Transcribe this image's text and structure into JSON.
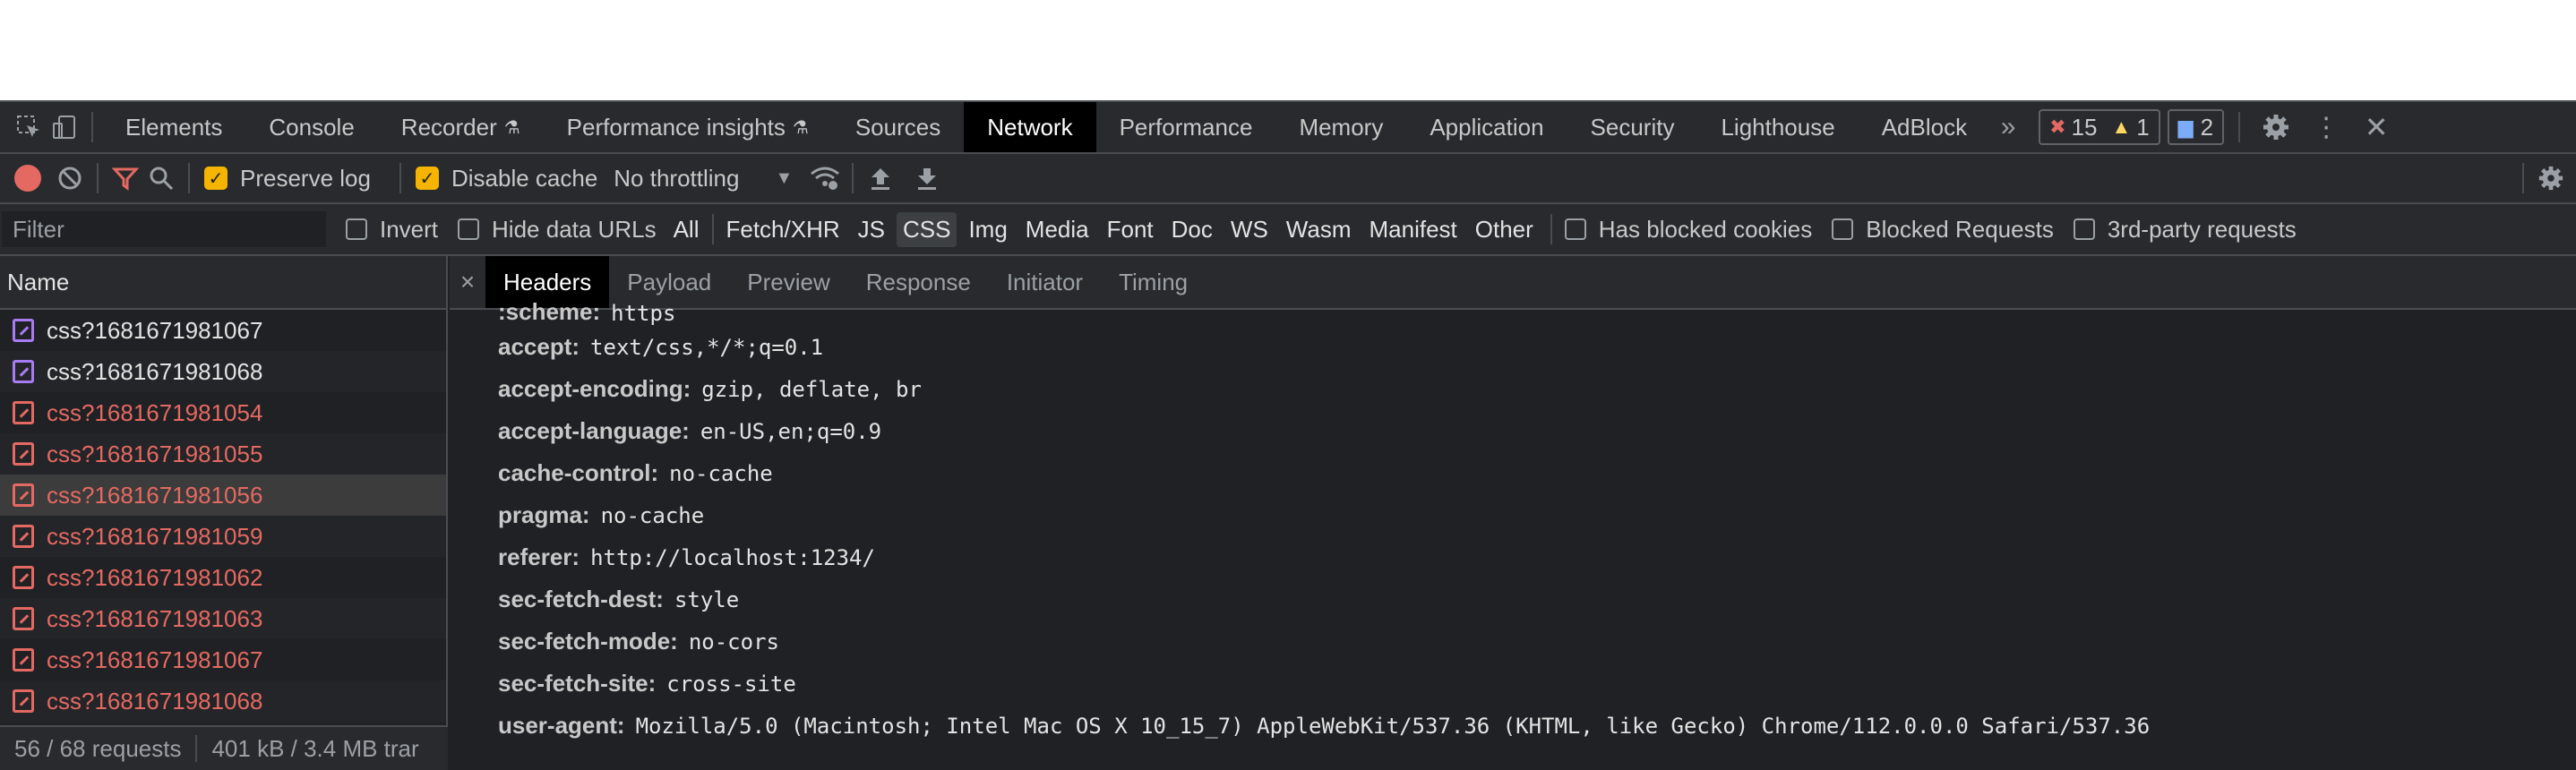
{
  "main_tabs": [
    "Elements",
    "Console",
    "Recorder",
    "Performance insights",
    "Sources",
    "Network",
    "Performance",
    "Memory",
    "Application",
    "Security",
    "Lighthouse",
    "AdBlock"
  ],
  "counters": {
    "errors": "15",
    "warnings": "1",
    "issues": "2"
  },
  "toolbar": {
    "preserve_log": "Preserve log",
    "disable_cache": "Disable cache",
    "throttling": "No throttling"
  },
  "filter": {
    "placeholder": "Filter",
    "invert": "Invert",
    "hide_data_urls": "Hide data URLs",
    "types": [
      "All",
      "Fetch/XHR",
      "JS",
      "CSS",
      "Img",
      "Media",
      "Font",
      "Doc",
      "WS",
      "Wasm",
      "Manifest",
      "Other"
    ],
    "has_blocked_cookies": "Has blocked cookies",
    "blocked_requests": "Blocked Requests",
    "third_party": "3rd-party requests"
  },
  "list": {
    "header": "Name",
    "rows": [
      "css?1681671981067",
      "css?1681671981068",
      "css?1681671981054",
      "css?1681671981055",
      "css?1681671981056",
      "css?1681671981059",
      "css?1681671981062",
      "css?1681671981063",
      "css?1681671981067",
      "css?1681671981068"
    ],
    "requests": "56 / 68 requests",
    "transferred": "401 kB / 3.4 MB trar"
  },
  "detail": {
    "close": "×",
    "tabs": [
      "Headers",
      "Payload",
      "Preview",
      "Response",
      "Initiator",
      "Timing"
    ],
    "headers": [
      {
        "key": ":scheme:",
        "value": "https"
      },
      {
        "key": "accept:",
        "value": "text/css,*/*;q=0.1"
      },
      {
        "key": "accept-encoding:",
        "value": "gzip, deflate, br"
      },
      {
        "key": "accept-language:",
        "value": "en-US,en;q=0.9"
      },
      {
        "key": "cache-control:",
        "value": "no-cache"
      },
      {
        "key": "pragma:",
        "value": "no-cache"
      },
      {
        "key": "referer:",
        "value": "http://localhost:1234/"
      },
      {
        "key": "sec-fetch-dest:",
        "value": "style"
      },
      {
        "key": "sec-fetch-mode:",
        "value": "no-cors"
      },
      {
        "key": "sec-fetch-site:",
        "value": "cross-site"
      },
      {
        "key": "user-agent:",
        "value": "Mozilla/5.0 (Macintosh; Intel Mac OS X 10_15_7) AppleWebKit/537.36 (KHTML, like Gecko) Chrome/112.0.0.0 Safari/537.36"
      }
    ]
  }
}
